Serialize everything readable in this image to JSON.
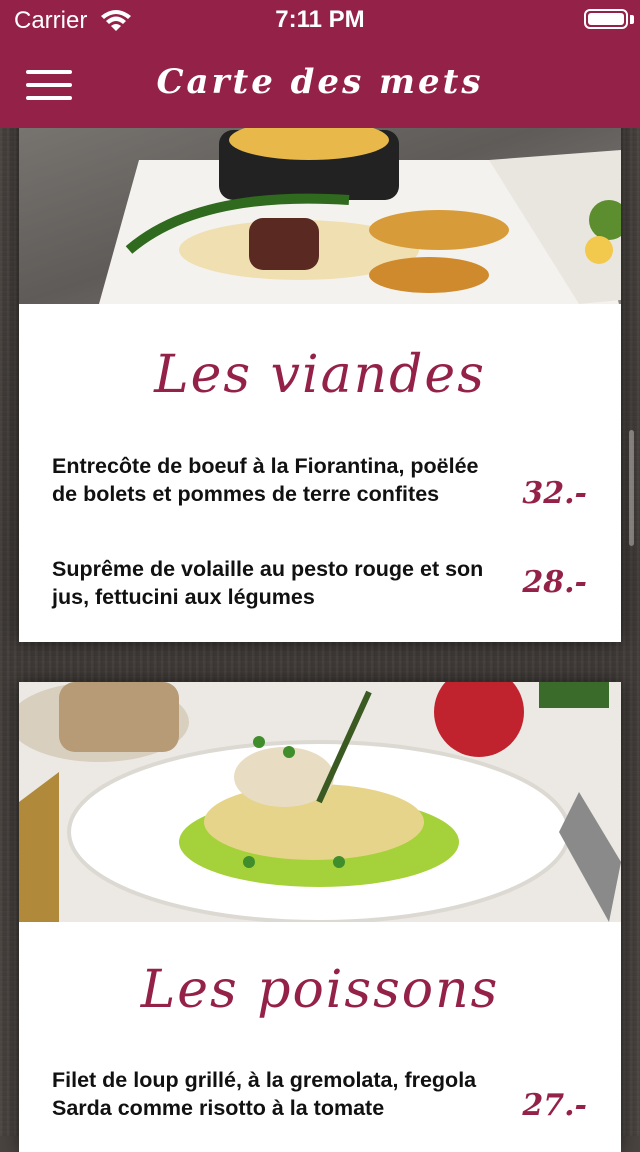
{
  "status": {
    "carrier": "Carrier",
    "time": "7:11 PM"
  },
  "nav": {
    "title": "Carte des mets"
  },
  "sections": [
    {
      "heading": "Les viandes",
      "photo": "meat-dish-photo",
      "items": [
        {
          "name": "Entrecôte de boeuf à la Fiorantina, poëlée de bolets et pommes de terre confites",
          "price": "32.-"
        },
        {
          "name": "Suprême de volaille au pesto rouge et son jus, fettucini aux légumes",
          "price": "28.-"
        }
      ]
    },
    {
      "heading": "Les poissons",
      "photo": "fish-dish-photo",
      "items": [
        {
          "name": "Filet de loup grillé, à la gremolata, fregola Sarda comme risotto à la tomate",
          "price": "27.-"
        }
      ]
    }
  ],
  "colors": {
    "brand": "#942147",
    "card": "#ffffff",
    "background": "#4a4440"
  }
}
